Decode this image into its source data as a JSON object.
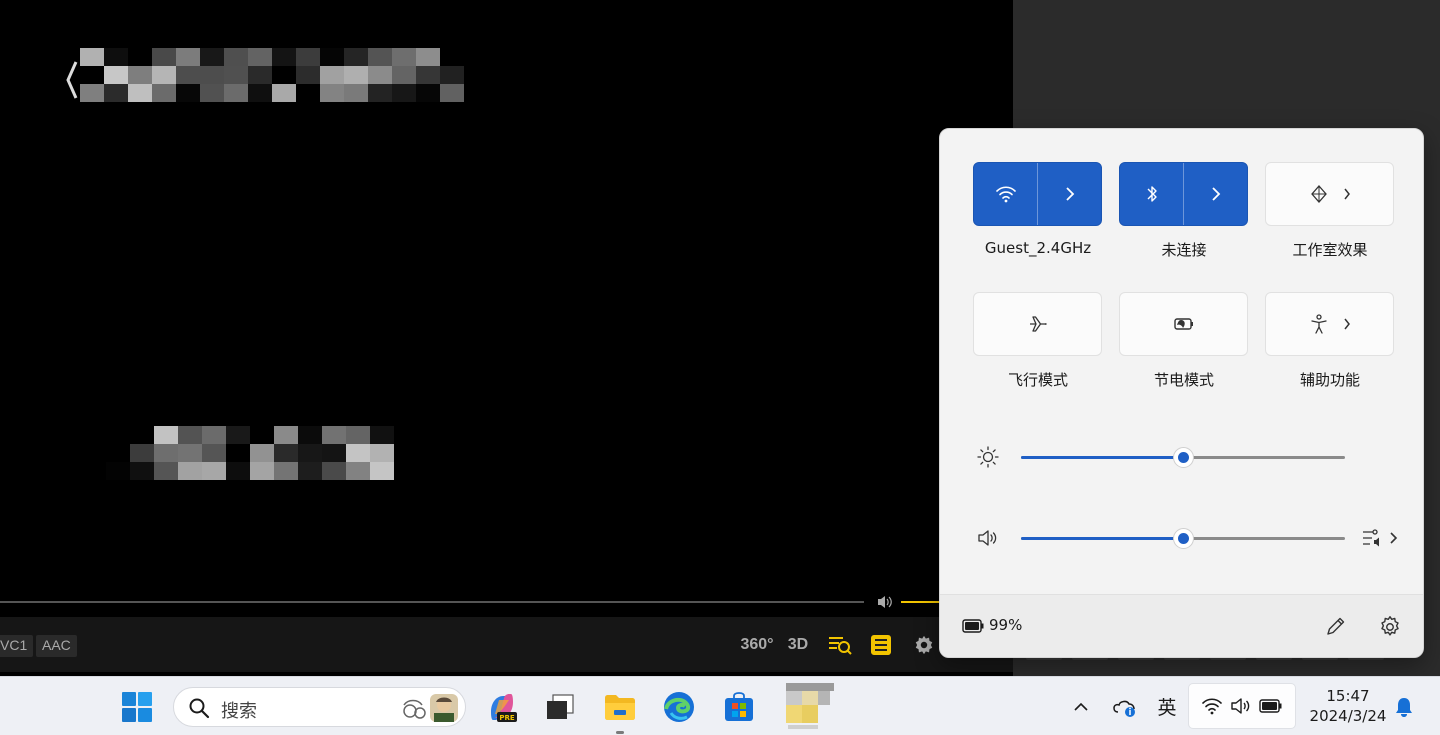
{
  "player": {
    "codec_video": "VC1",
    "codec_audio": "AAC",
    "btn_360": "360°",
    "btn_3d": "3D"
  },
  "quick_settings": {
    "tiles": [
      {
        "label": "Guest_2.4GHz",
        "icon": "wifi-icon",
        "state": "on"
      },
      {
        "label": "未连接",
        "icon": "bluetooth-icon",
        "state": "on"
      },
      {
        "label": "工作室效果",
        "icon": "studio-effects-icon",
        "state": "off"
      },
      {
        "label": "飞行模式",
        "icon": "airplane-icon",
        "state": "off"
      },
      {
        "label": "节电模式",
        "icon": "battery-saver-icon",
        "state": "off"
      },
      {
        "label": "辅助功能",
        "icon": "accessibility-icon",
        "state": "off"
      }
    ],
    "brightness": {
      "icon": "brightness-icon",
      "value": 0.5
    },
    "volume": {
      "icon": "speaker-icon",
      "value": 0.5
    },
    "battery_percent": "99%"
  },
  "taskbar": {
    "search_placeholder": "搜索",
    "ime_indicator": "英",
    "clock_time": "15:47",
    "clock_date": "2024/3/24"
  },
  "colors": {
    "accent": "#1f5fc5",
    "player_accent": "#f2c400",
    "flyout_bg": "#f3f3f3"
  }
}
